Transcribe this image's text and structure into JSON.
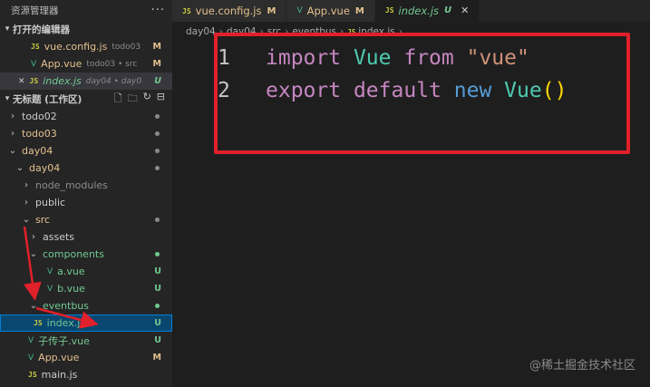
{
  "explorer": {
    "title": "资源管理器",
    "more": "···",
    "open_editors": {
      "label": "打开的编辑器",
      "items": [
        {
          "icon": "JS",
          "name": "vue.config.js",
          "desc": "todo03",
          "badge": "M"
        },
        {
          "icon": "V",
          "name": "App.vue",
          "desc": "todo03 • src",
          "badge": "M"
        },
        {
          "icon": "JS",
          "name": "index.js",
          "desc": "day04 • day04...",
          "badge": "U",
          "close": "✕"
        }
      ]
    },
    "workspace": {
      "label": "无标题 (工作区)",
      "tools": [
        "new-file-icon",
        "new-folder-icon",
        "refresh-icon",
        "collapse-icon"
      ]
    },
    "tree": [
      {
        "chevron": "›",
        "name": "todo02"
      },
      {
        "chevron": "›",
        "name": "todo03"
      },
      {
        "chevron": "⌄",
        "name": "day04"
      },
      {
        "chevron": "⌄",
        "name": "day04"
      },
      {
        "chevron": "›",
        "name": "node_modules"
      },
      {
        "chevron": "›",
        "name": "public"
      },
      {
        "chevron": "⌄",
        "name": "src"
      },
      {
        "chevron": "›",
        "name": "assets"
      },
      {
        "chevron": "⌄",
        "name": "components"
      },
      {
        "icon": "V",
        "name": "a.vue",
        "badge": "U"
      },
      {
        "icon": "V",
        "name": "b.vue",
        "badge": "U"
      },
      {
        "chevron": "⌄",
        "name": "eventbus"
      },
      {
        "icon": "JS",
        "name": "index.js",
        "badge": "U"
      },
      {
        "icon": "V",
        "name": "子传子.vue",
        "badge": "U"
      },
      {
        "icon": "V",
        "name": "App.vue",
        "badge": "M"
      },
      {
        "icon": "JS",
        "name": "main.js"
      }
    ]
  },
  "tabs": [
    {
      "icon": "JS",
      "name": "vue.config.js",
      "badge": "M"
    },
    {
      "icon": "V",
      "name": "App.vue",
      "badge": "M"
    },
    {
      "icon": "JS",
      "name": "index.js",
      "badge": "U",
      "close": "✕"
    }
  ],
  "breadcrumb": {
    "parts": [
      "day04",
      "day04",
      "src",
      "eventbus"
    ],
    "file_icon": "JS",
    "file": "index.js",
    "tail": "..."
  },
  "editor": {
    "lines": [
      {
        "n": "1",
        "t": [
          "import",
          " ",
          "Vue",
          " ",
          "from",
          " ",
          "\"vue\""
        ]
      },
      {
        "n": "2",
        "t": [
          "export",
          " ",
          "default",
          " ",
          "new",
          " ",
          "Vue",
          "(",
          ")"
        ]
      }
    ]
  },
  "colors": {
    "modified": "#e2c08d",
    "untracked": "#73c991",
    "annotation_red": "#e0202a",
    "selection": "#094771"
  },
  "watermark": "@稀土掘金技术社区"
}
